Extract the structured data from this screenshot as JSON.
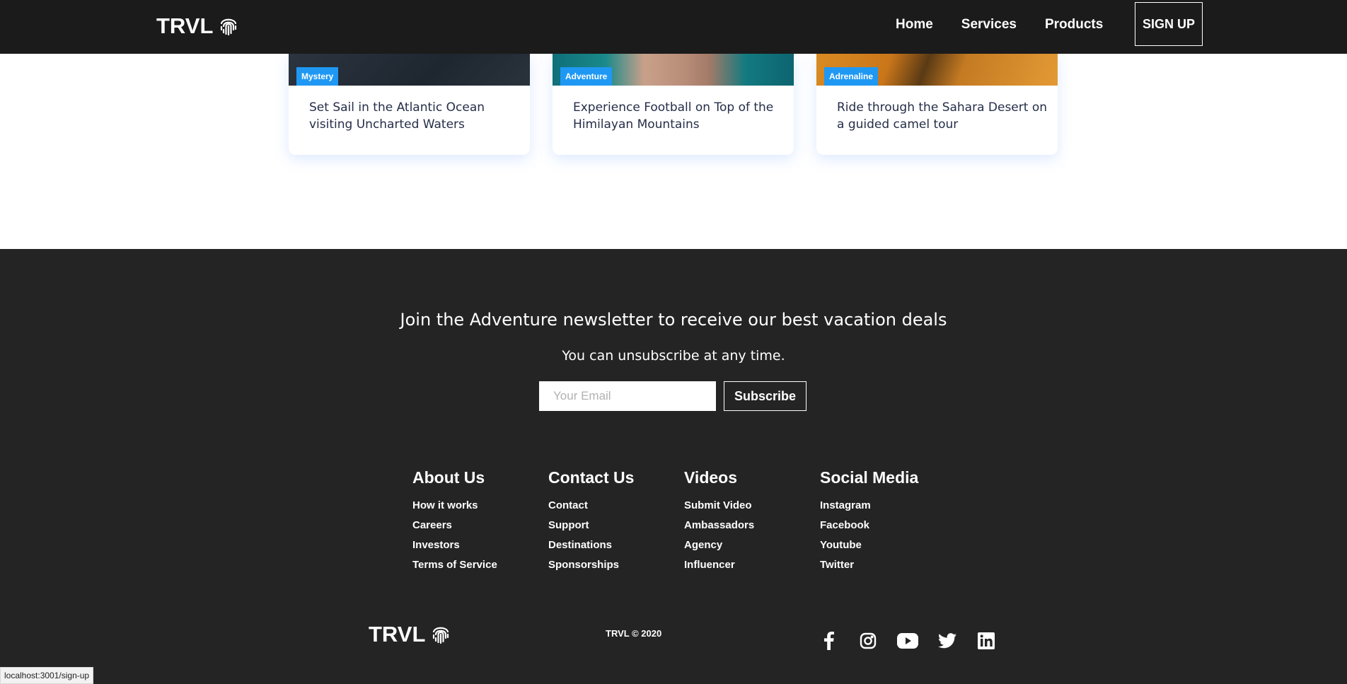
{
  "header": {
    "logo_text": "TRVL",
    "nav": [
      "Home",
      "Services",
      "Products"
    ],
    "signup_label": "SIGN UP"
  },
  "cards": [
    {
      "badge": "Mystery",
      "title": "Set Sail in the Atlantic Ocean visiting Uncharted Waters"
    },
    {
      "badge": "Adventure",
      "title": "Experience Football on Top of the Himilayan Mountains"
    },
    {
      "badge": "Adrenaline",
      "title": "Ride through the Sahara Desert on a guided camel tour"
    }
  ],
  "newsletter": {
    "heading": "Join the Adventure newsletter to receive our best vacation deals",
    "subtext": "You can unsubscribe at any time.",
    "email_placeholder": "Your Email",
    "subscribe_label": "Subscribe"
  },
  "footer_links": [
    {
      "title": "About Us",
      "items": [
        "How it works",
        "Careers",
        "Investors",
        "Terms of Service"
      ]
    },
    {
      "title": "Contact Us",
      "items": [
        "Contact",
        "Support",
        "Destinations",
        "Sponsorships"
      ]
    },
    {
      "title": "Videos",
      "items": [
        "Submit Video",
        "Ambassadors",
        "Agency",
        "Influencer"
      ]
    },
    {
      "title": "Social Media",
      "items": [
        "Instagram",
        "Facebook",
        "Youtube",
        "Twitter"
      ]
    }
  ],
  "footer_bottom": {
    "logo_text": "TRVL",
    "copyright": "TRVL © 2020",
    "social_icons": [
      "facebook-icon",
      "instagram-icon",
      "youtube-icon",
      "twitter-icon",
      "linkedin-icon"
    ]
  },
  "status_bar": {
    "url": "localhost:3001/sign-up"
  },
  "colors": {
    "navbar": "#1b1b1b",
    "footer": "#242424",
    "badge": "#1f98f4",
    "card_text": "#252e48"
  }
}
